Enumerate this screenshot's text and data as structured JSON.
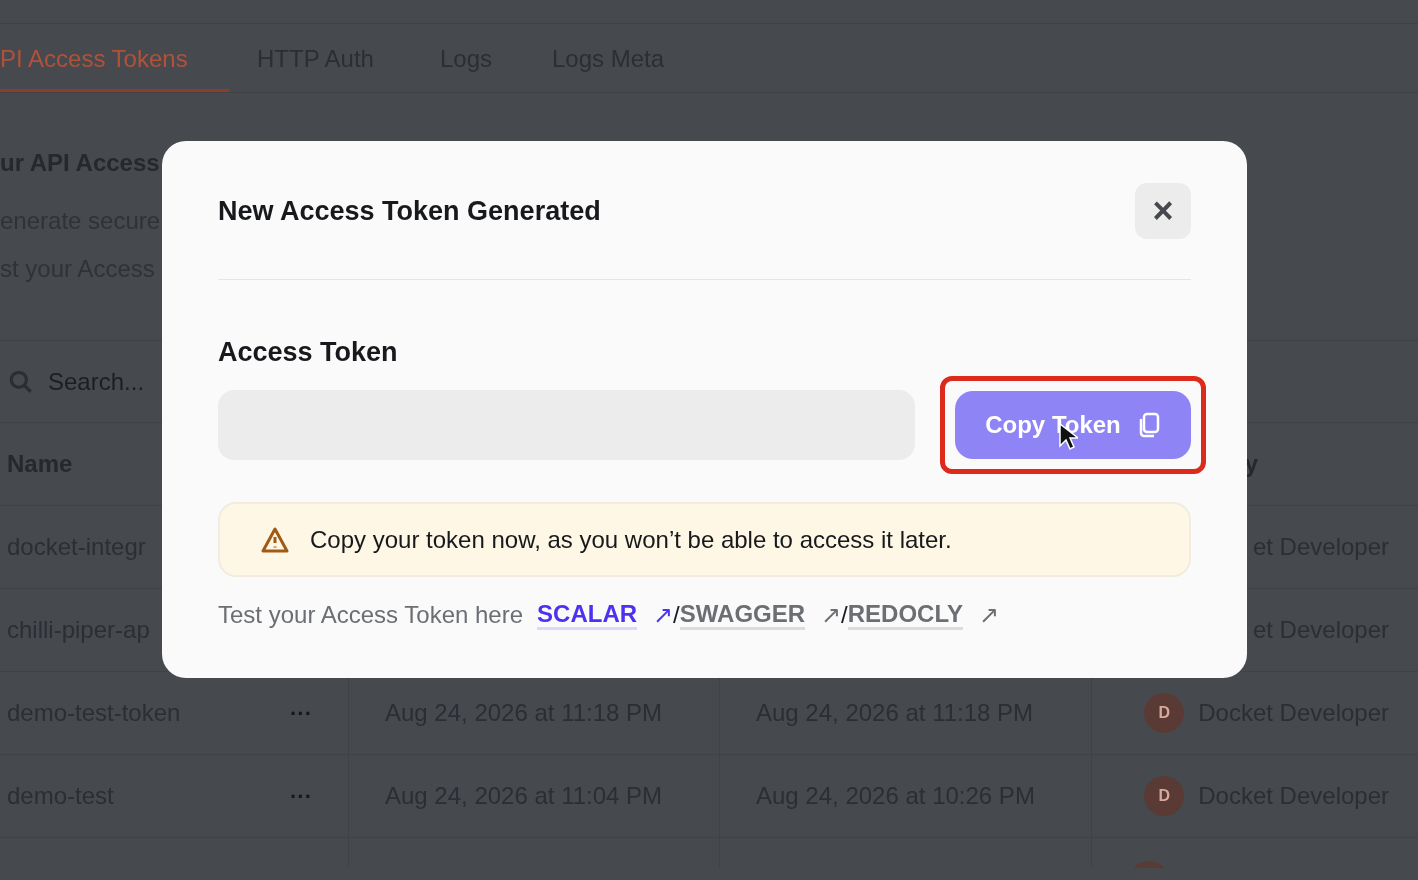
{
  "tabs": [
    {
      "label": "PI Access Tokens",
      "selected": true
    },
    {
      "label": "HTTP Auth",
      "selected": false
    },
    {
      "label": "Logs",
      "selected": false
    },
    {
      "label": "Logs Meta",
      "selected": false
    }
  ],
  "section": {
    "heading": "ur API Access",
    "lines": [
      "enerate secure",
      "st your Access"
    ]
  },
  "search": {
    "placeholder": "Search..."
  },
  "table": {
    "columns": [
      "Name",
      "",
      "",
      "",
      "y"
    ],
    "rows": [
      {
        "name": "docket-integr",
        "created_by": "et Developer"
      },
      {
        "name": "chilli-piper-ap",
        "created_by": "et Developer"
      },
      {
        "name": "demo-test-token",
        "menu": "···",
        "column_3": "Aug 24, 2026 at 11:18 PM",
        "column_4": "Aug 24, 2026 at 11:18 PM",
        "avatar": "D",
        "created_by": "Docket Developer"
      },
      {
        "name": "demo-test",
        "menu": "···",
        "column_3": "Aug 24, 2026 at 11:04 PM",
        "column_4": "Aug 24, 2026 at 10:26 PM",
        "avatar": "D",
        "created_by": "Docket Developer"
      }
    ]
  },
  "modal": {
    "title": "New Access Token Generated",
    "close": "×",
    "field_label": "Access Token",
    "copy_button": {
      "label": "Copy Token",
      "highlighted": true
    },
    "warning": "Copy your token now, as you won’t be able to access it later.",
    "test_text": "Test your Access Token here",
    "links": [
      {
        "label": "SCALAR",
        "arrow": "↗",
        "selected": true
      },
      {
        "label": "SWAGGER",
        "arrow": "↗",
        "selected": false
      },
      {
        "label": "REDOCLY",
        "arrow": "↗",
        "selected": false
      }
    ],
    "separator": "/"
  }
}
